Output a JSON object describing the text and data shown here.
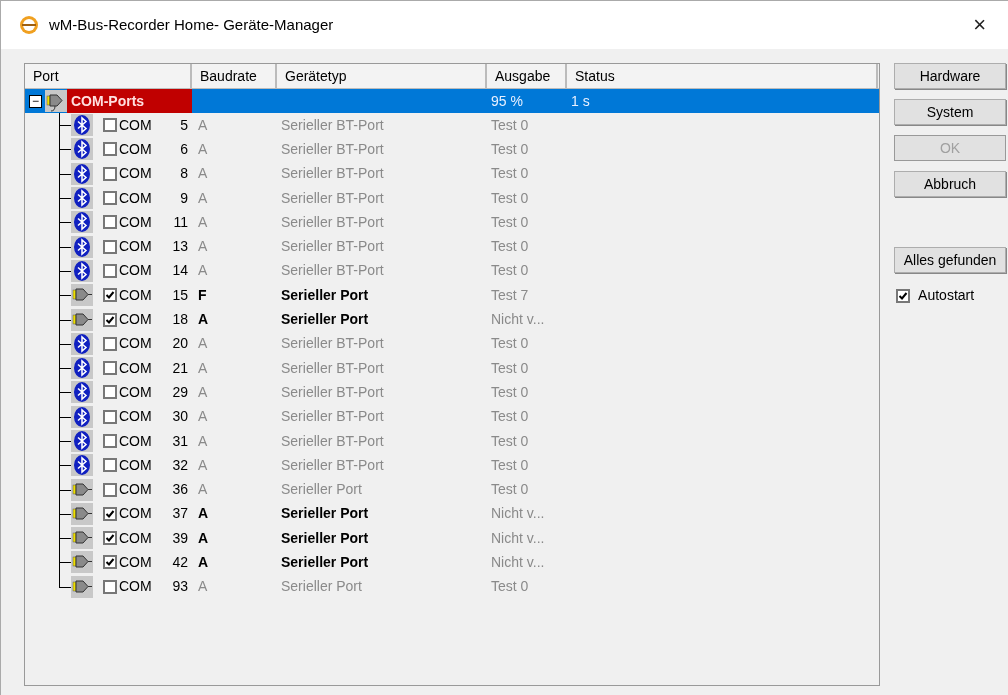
{
  "window": {
    "title": "wM-Bus-Recorder Home- Geräte-Manager",
    "close": "×"
  },
  "table": {
    "columns": [
      "Port",
      "Baudrate",
      "Gerätetyp",
      "Ausgabe",
      "Status"
    ],
    "root": {
      "label": "COM-Ports",
      "expanded": true,
      "selected": true,
      "expander": "−",
      "output": "95 %",
      "status": "1 s"
    },
    "rows": [
      {
        "kind": "bluetooth",
        "checked": false,
        "port": "COM",
        "number": "5",
        "baud": "A",
        "type": "Serieller BT-Port",
        "output": "Test 0"
      },
      {
        "kind": "bluetooth",
        "checked": false,
        "port": "COM",
        "number": "6",
        "baud": "A",
        "type": "Serieller BT-Port",
        "output": "Test 0"
      },
      {
        "kind": "bluetooth",
        "checked": false,
        "port": "COM",
        "number": "8",
        "baud": "A",
        "type": "Serieller BT-Port",
        "output": "Test 0"
      },
      {
        "kind": "bluetooth",
        "checked": false,
        "port": "COM",
        "number": "9",
        "baud": "A",
        "type": "Serieller BT-Port",
        "output": "Test 0"
      },
      {
        "kind": "bluetooth",
        "checked": false,
        "port": "COM",
        "number": "11",
        "baud": "A",
        "type": "Serieller BT-Port",
        "output": "Test 0"
      },
      {
        "kind": "bluetooth",
        "checked": false,
        "port": "COM",
        "number": "13",
        "baud": "A",
        "type": "Serieller BT-Port",
        "output": "Test 0"
      },
      {
        "kind": "bluetooth",
        "checked": false,
        "port": "COM",
        "number": "14",
        "baud": "A",
        "type": "Serieller BT-Port",
        "output": "Test 0"
      },
      {
        "kind": "serial",
        "checked": true,
        "port": "COM",
        "number": "15",
        "baud": "F",
        "type": "Serieller Port",
        "output": "Test 7"
      },
      {
        "kind": "serial",
        "checked": true,
        "port": "COM",
        "number": "18",
        "baud": "A",
        "type": "Serieller Port",
        "output": "Nicht v..."
      },
      {
        "kind": "bluetooth",
        "checked": false,
        "port": "COM",
        "number": "20",
        "baud": "A",
        "type": "Serieller BT-Port",
        "output": "Test 0"
      },
      {
        "kind": "bluetooth",
        "checked": false,
        "port": "COM",
        "number": "21",
        "baud": "A",
        "type": "Serieller BT-Port",
        "output": "Test 0"
      },
      {
        "kind": "bluetooth",
        "checked": false,
        "port": "COM",
        "number": "29",
        "baud": "A",
        "type": "Serieller BT-Port",
        "output": "Test 0"
      },
      {
        "kind": "bluetooth",
        "checked": false,
        "port": "COM",
        "number": "30",
        "baud": "A",
        "type": "Serieller BT-Port",
        "output": "Test 0"
      },
      {
        "kind": "bluetooth",
        "checked": false,
        "port": "COM",
        "number": "31",
        "baud": "A",
        "type": "Serieller BT-Port",
        "output": "Test 0"
      },
      {
        "kind": "bluetooth",
        "checked": false,
        "port": "COM",
        "number": "32",
        "baud": "A",
        "type": "Serieller BT-Port",
        "output": "Test 0"
      },
      {
        "kind": "serial",
        "checked": false,
        "port": "COM",
        "number": "36",
        "baud": "A",
        "type": "Serieller Port",
        "output": "Test 0"
      },
      {
        "kind": "serial",
        "checked": true,
        "port": "COM",
        "number": "37",
        "baud": "A",
        "type": "Serieller Port",
        "output": "Nicht v..."
      },
      {
        "kind": "serial",
        "checked": true,
        "port": "COM",
        "number": "39",
        "baud": "A",
        "type": "Serieller Port",
        "output": "Nicht v..."
      },
      {
        "kind": "serial",
        "checked": true,
        "port": "COM",
        "number": "42",
        "baud": "A",
        "type": "Serieller Port",
        "output": "Nicht v..."
      },
      {
        "kind": "serial",
        "checked": false,
        "port": "COM",
        "number": "93",
        "baud": "A",
        "type": "Serieller Port",
        "output": "Test 0"
      }
    ]
  },
  "buttons": [
    {
      "label": "Hardware",
      "disabled": false
    },
    {
      "label": "System",
      "disabled": false
    },
    {
      "label": "OK",
      "disabled": true
    },
    {
      "label": "Abbruch",
      "disabled": false
    }
  ],
  "extra_button": {
    "label": "Alles gefunden",
    "disabled": false
  },
  "autostart": {
    "label": "Autostart",
    "checked": true
  }
}
